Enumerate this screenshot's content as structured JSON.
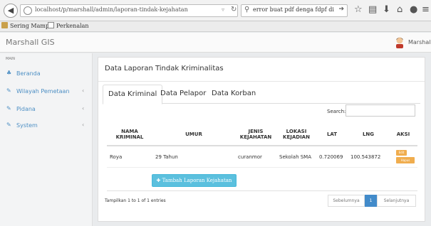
{
  "browser": {
    "url": "localhost/p/marshall/admin/laporan-tindak-kejahatan",
    "search_text": "error buat pdf denga fdpf di"
  },
  "bookmarks": [
    "Sering Mampir",
    "Perkenalan"
  ],
  "app": {
    "title": "Marshall GIS",
    "user": "Marshall"
  },
  "sidebar": {
    "section": "MAIN",
    "items": [
      {
        "label": "Beranda",
        "icon": "dashboard-icon",
        "chevron": false
      },
      {
        "label": "Wilayah Pemetaan",
        "icon": "edit-icon",
        "chevron": true
      },
      {
        "label": "Pidana",
        "icon": "edit-icon",
        "chevron": true
      },
      {
        "label": "System",
        "icon": "edit-icon",
        "chevron": true
      }
    ]
  },
  "panel": {
    "title": "Data Laporan Tindak Kriminalitas",
    "tabs": [
      "Data Kriminal",
      "Data Pelapor",
      "Data Korban"
    ],
    "search_label": "Search:",
    "columns": [
      "NAMA KRIMINAL",
      "UMUR",
      "JENIS KEJAHATAN",
      "LOKASI KEJADIAN",
      "LAT",
      "LNG",
      "AKSI"
    ],
    "rows": [
      {
        "nama": "Roya",
        "umur": "29 Tahun",
        "jenis": "curanmor",
        "lokasi": "Sekolah SMA",
        "lat": "0.720069",
        "lng": "100.543872",
        "edit": "Edit",
        "hapus": "Hapus"
      }
    ],
    "add_button": "Tambah Laporan Kejahatan",
    "info": "Tampilkan 1 to 1 of 1 entries",
    "pager": {
      "prev": "Sebelumnya",
      "current": "1",
      "next": "Selanjutnya"
    }
  },
  "colors": {
    "accent": "#428bca",
    "sidebar_link": "#4d8fc4",
    "warning": "#f0ad4e",
    "info": "#5bc0de"
  }
}
